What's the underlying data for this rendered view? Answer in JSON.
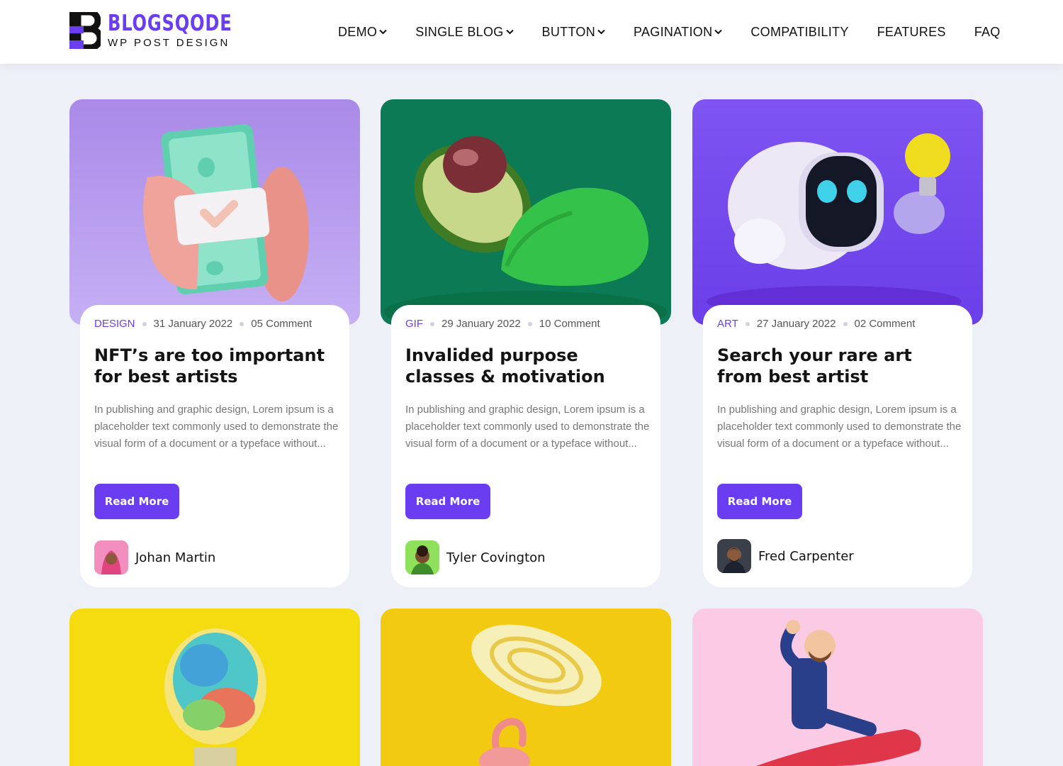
{
  "brand": {
    "name": "BLOGSQODE",
    "tagline": "WP POST DESIGN",
    "accent": "#6a3df0"
  },
  "nav": {
    "items": [
      {
        "label": "DEMO",
        "has_dropdown": true
      },
      {
        "label": "SINGLE BLOG",
        "has_dropdown": true
      },
      {
        "label": "BUTTON",
        "has_dropdown": true
      },
      {
        "label": "PAGINATION",
        "has_dropdown": true
      },
      {
        "label": "COMPATIBILITY",
        "has_dropdown": false
      },
      {
        "label": "FEATURES",
        "has_dropdown": false
      },
      {
        "label": "FAQ",
        "has_dropdown": false
      }
    ]
  },
  "posts": [
    {
      "category": "DESIGN",
      "date": "31 January 2022",
      "comments": "05 Comment",
      "title": "NFT’s are too important for best artists",
      "excerpt": "In publishing and graphic design, Lorem ipsum is a placeholder text commonly used to demonstrate the visual form of a document or a typeface without...",
      "button": "Read More",
      "author": "Johan Martin",
      "image_bg": "#b59af0",
      "image": "hand-holding-cash-illustration",
      "avatar_bg": "#f06aa8"
    },
    {
      "category": "GIF",
      "date": "29 January 2022",
      "comments": "10 Comment",
      "title": "Invalided purpose classes & motivation",
      "excerpt": "In publishing and graphic design, Lorem ipsum is a placeholder text commonly used to demonstrate the visual form of a document or a typeface without...",
      "button": "Read More",
      "author": "Tyler Covington",
      "image_bg": "#0b7a55",
      "image": "avocado-halves-illustration",
      "avatar_bg": "#8fe05a"
    },
    {
      "category": "ART",
      "date": "27 January 2022",
      "comments": "02 Comment",
      "title": "Search your rare art from best artist",
      "excerpt": "In publishing and graphic design, Lorem ipsum is a placeholder text commonly used to demonstrate the visual form of a document or a typeface without...",
      "button": "Read More",
      "author": "Fred Carpenter",
      "image_bg": "#7a4ff0",
      "image": "robot-with-lightbulb-illustration",
      "avatar_bg": "#3a3f4a"
    }
  ],
  "row2": [
    {
      "image_bg": "#f5dc10",
      "image": "brain-lightbulb-illustration"
    },
    {
      "image_bg": "#f2ca12",
      "image": "flamingo-sunhat-illustration"
    },
    {
      "image_bg": "#fbcbe6",
      "image": "businessman-on-rocket-illustration"
    }
  ]
}
